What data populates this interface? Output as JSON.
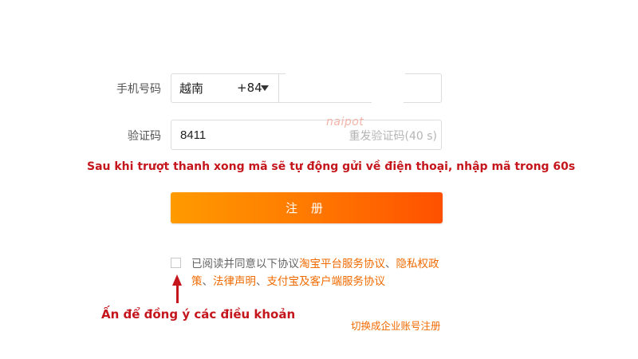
{
  "form": {
    "phone_label": "手机号码",
    "country": "越南",
    "country_code": "+84",
    "phone_value": "",
    "code_label": "验证码",
    "code_value": "8411",
    "resend_label": "重发验证码(40 s)",
    "register_label": "注 册",
    "agreement": {
      "prefix": "已阅读并同意以下协议",
      "link_1": "淘宝平台服务协议",
      "sep_1": "、",
      "link_2": "隐私权政策",
      "sep_2": "、",
      "link_3": "法律声明",
      "sep_3": "、",
      "link_4": "支付宝及客户端服务协议"
    },
    "switch_link": "切换成企业账号注册"
  },
  "annotations": {
    "instruction": "Sau khi trượt thanh xong mã sẽ tự động gửi về điện thoại, nhập mã trong 60s",
    "checkbox_hint": "Ấn để đồng ý các điều khoản"
  },
  "watermark": "naipot",
  "colors": {
    "accent_orange": "#ff5000",
    "annotation_red": "#c4161c",
    "link_orange": "#f06a00"
  }
}
